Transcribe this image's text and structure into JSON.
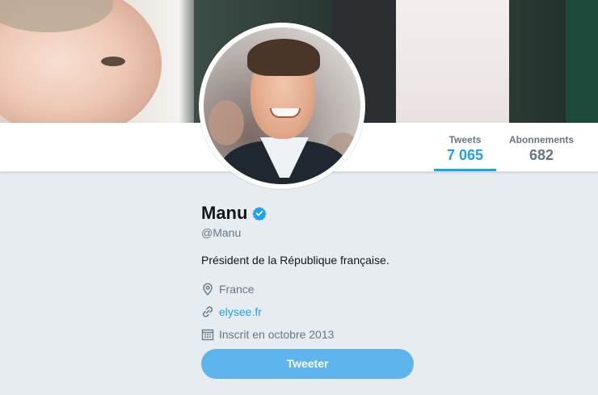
{
  "nav": {
    "tweets_label": "Tweets",
    "tweets_count": "7 065",
    "following_label": "Abonnements",
    "following_count": "682"
  },
  "profile": {
    "name": "Manu",
    "handle": "@Manu",
    "bio": "Président de la République française.",
    "location": "France",
    "website": "elysee.fr",
    "joined": "Inscrit en octobre 2013"
  },
  "actions": {
    "tweet_button": "Tweeter"
  },
  "icons": {
    "verified": "verified-badge-icon",
    "location": "location-pin-icon",
    "link": "link-icon",
    "calendar": "calendar-icon"
  },
  "colors": {
    "accent": "#1da1f2",
    "button": "#5eb4ec",
    "background": "#e6ecf0",
    "text_secondary": "#657786"
  }
}
